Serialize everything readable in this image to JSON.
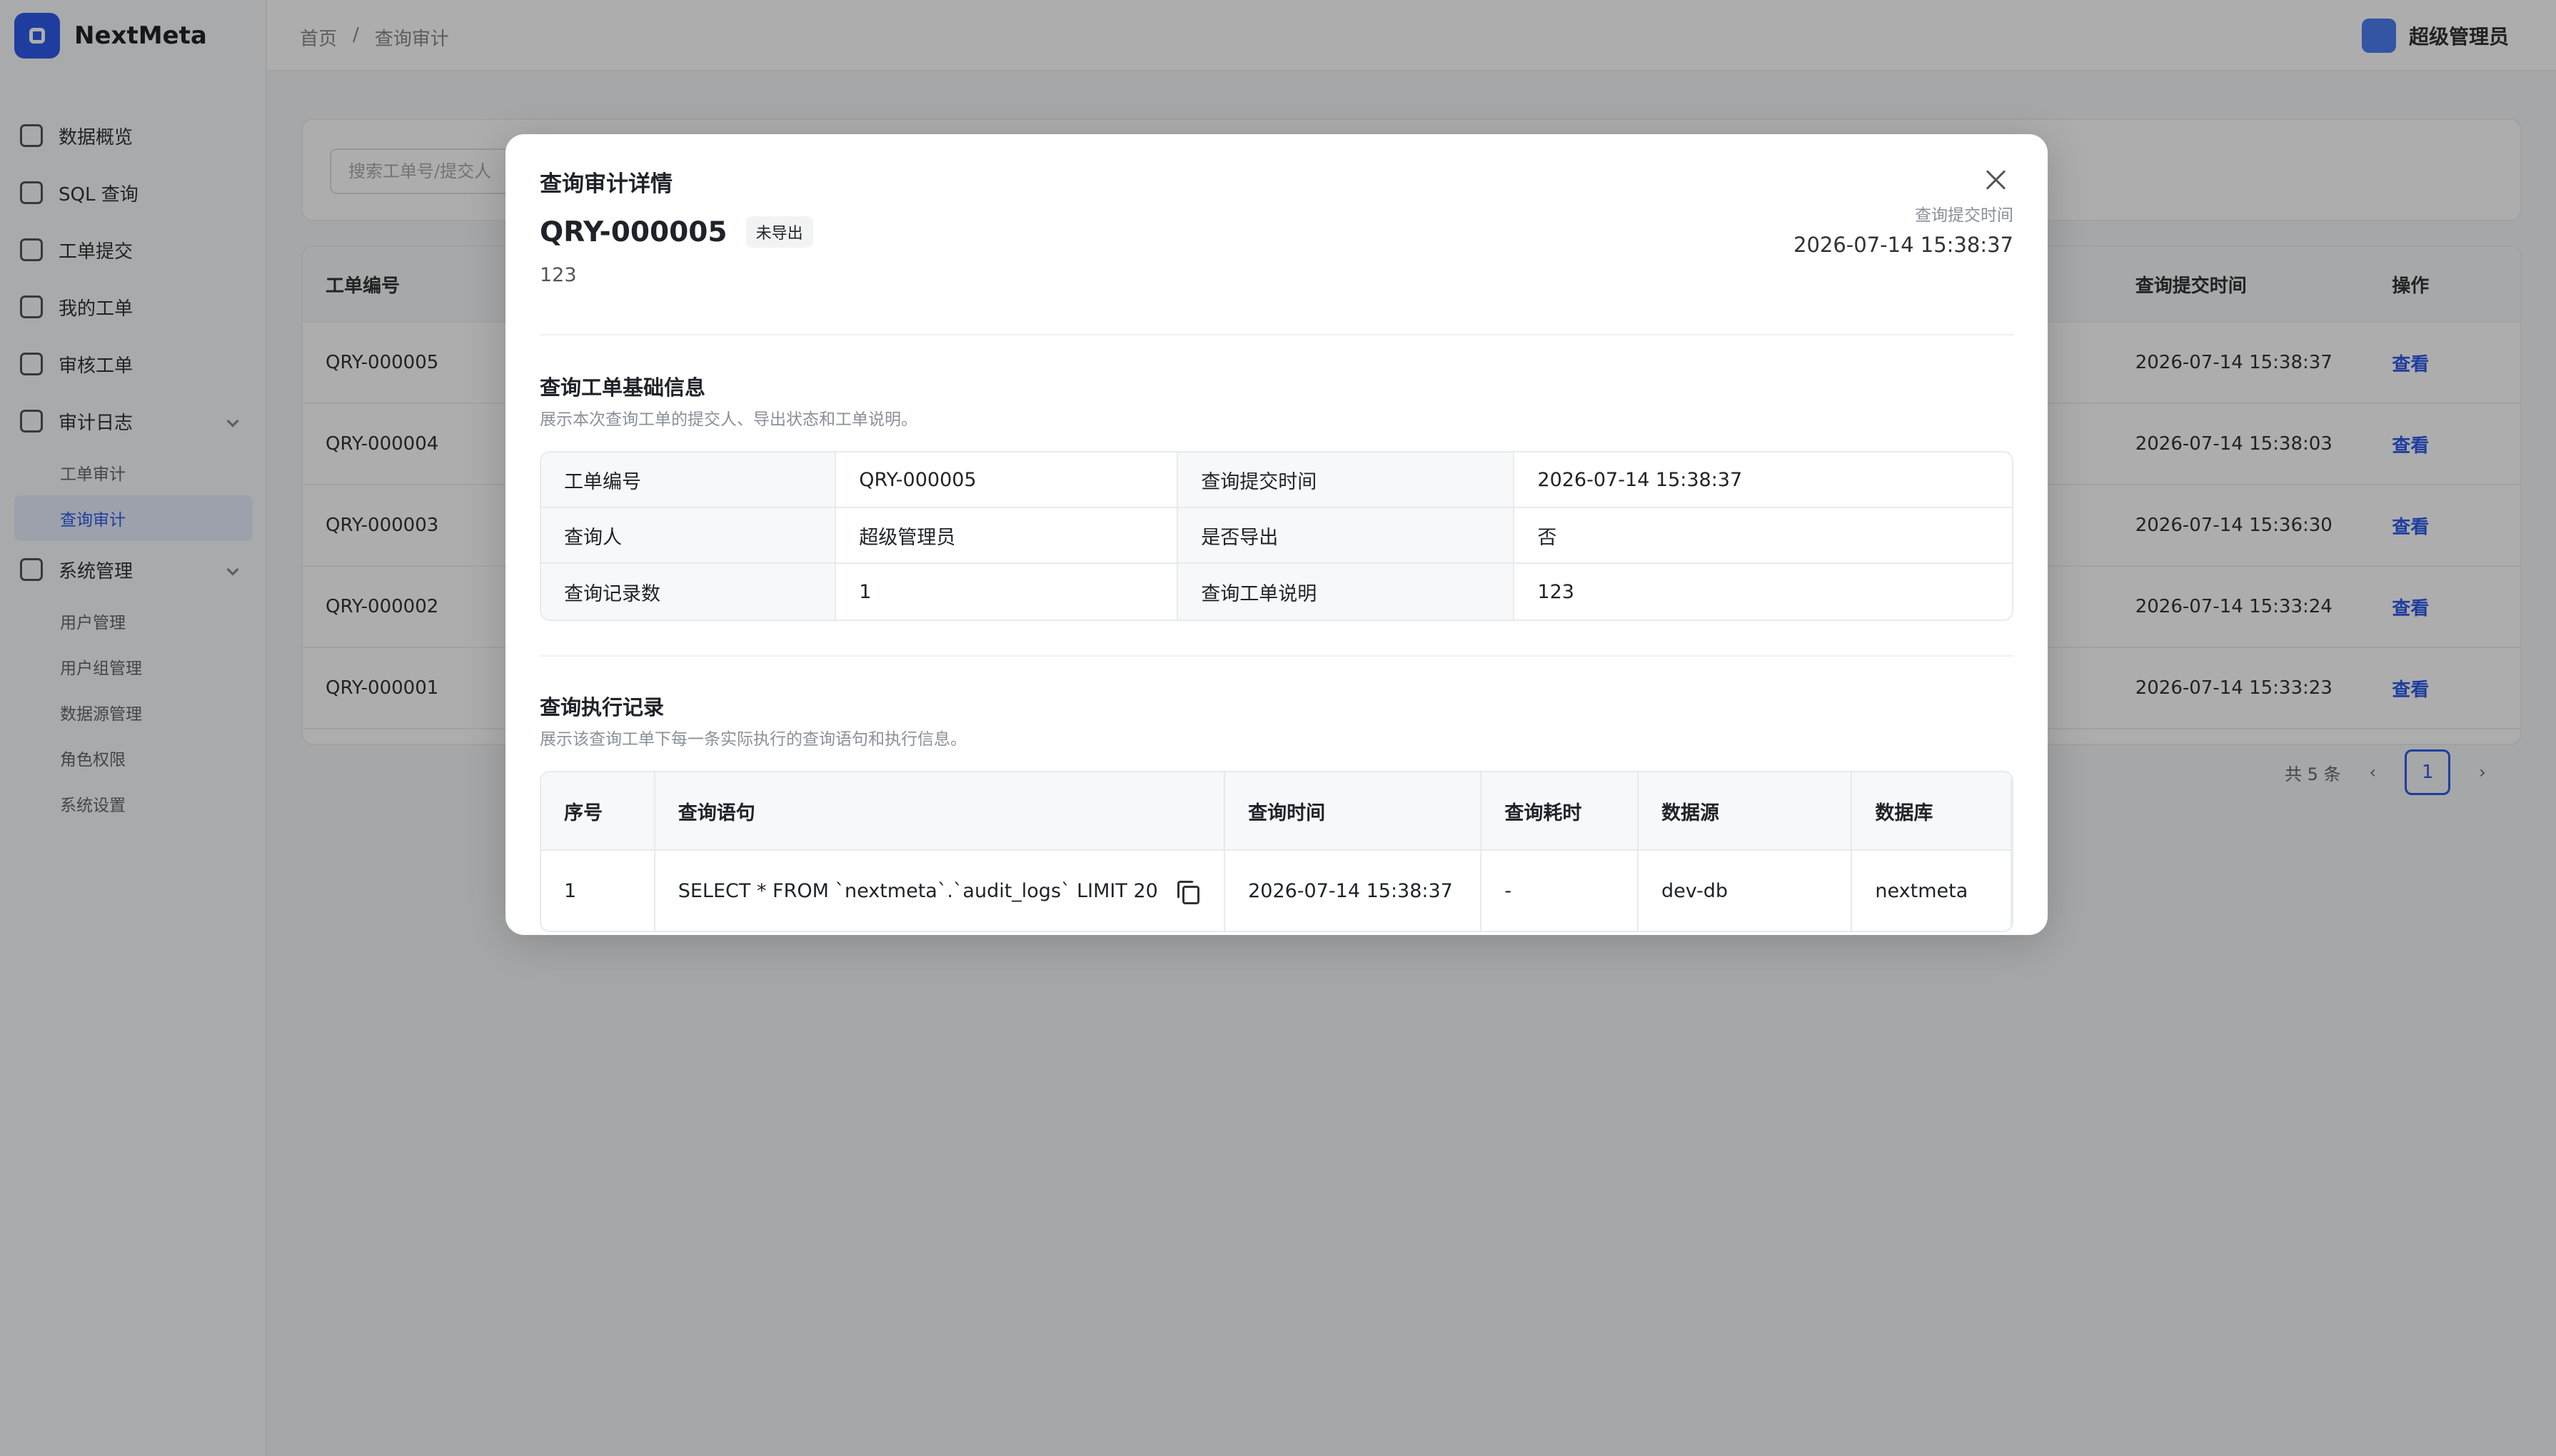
{
  "app": {
    "name": "NextMeta"
  },
  "sidebar": {
    "items": [
      {
        "label": "数据概览"
      },
      {
        "label": "SQL 查询"
      },
      {
        "label": "工单提交"
      },
      {
        "label": "我的工单"
      },
      {
        "label": "审核工单"
      },
      {
        "label": "审计日志"
      }
    ],
    "audit_children": [
      {
        "label": "工单审计"
      },
      {
        "label": "查询审计"
      }
    ],
    "system": {
      "label": "系统管理"
    },
    "system_children": [
      {
        "label": "用户管理"
      },
      {
        "label": "用户组管理"
      },
      {
        "label": "数据源管理"
      },
      {
        "label": "角色权限"
      },
      {
        "label": "系统设置"
      }
    ]
  },
  "topbar": {
    "breadcrumb": [
      "首页",
      "/",
      "查询审计"
    ],
    "user": "超级管理员"
  },
  "background": {
    "search_placeholder": "搜索工单号/提交人",
    "columns": [
      "工单编号",
      "查询提交时间",
      "操作"
    ],
    "rows": [
      {
        "id": "QRY-000005",
        "time": "2026-07-14 15:38:37",
        "action": "查看"
      },
      {
        "id": "QRY-000004",
        "time": "2026-07-14 15:38:03",
        "action": "查看"
      },
      {
        "id": "QRY-000003",
        "time": "2026-07-14 15:36:30",
        "action": "查看"
      },
      {
        "id": "QRY-000002",
        "time": "2026-07-14 15:33:24",
        "action": "查看"
      },
      {
        "id": "QRY-000001",
        "time": "2026-07-14 15:33:23",
        "action": "查看"
      }
    ],
    "pager": {
      "total": "共 5 条",
      "page": "1"
    }
  },
  "modal": {
    "title": "查询审计详情",
    "ticket_id": "QRY-000005",
    "export_badge": "未导出",
    "description": "123",
    "submit_time_label": "查询提交时间",
    "submit_time": "2026-07-14 15:38:37",
    "basic": {
      "title": "查询工单基础信息",
      "subtitle": "展示本次查询工单的提交人、导出状态和工单说明。",
      "rows": [
        {
          "k1": "工单编号",
          "v1": "QRY-000005",
          "k2": "查询提交时间",
          "v2": "2026-07-14 15:38:37"
        },
        {
          "k1": "查询人",
          "v1": "超级管理员",
          "k2": "是否导出",
          "v2": "否"
        },
        {
          "k1": "查询记录数",
          "v1": "1",
          "k2": "查询工单说明",
          "v2": "123"
        }
      ]
    },
    "exec": {
      "title": "查询执行记录",
      "subtitle": "展示该查询工单下每一条实际执行的查询语句和执行信息。",
      "columns": [
        "序号",
        "查询语句",
        "查询时间",
        "查询耗时",
        "数据源",
        "数据库"
      ],
      "rows": [
        {
          "no": "1",
          "sql": "SELECT * FROM `nextmeta`.`audit_logs` LIMIT 20",
          "time": "2026-07-14 15:38:37",
          "duration": "-",
          "datasource": "dev-db",
          "database": "nextmeta"
        }
      ]
    }
  }
}
